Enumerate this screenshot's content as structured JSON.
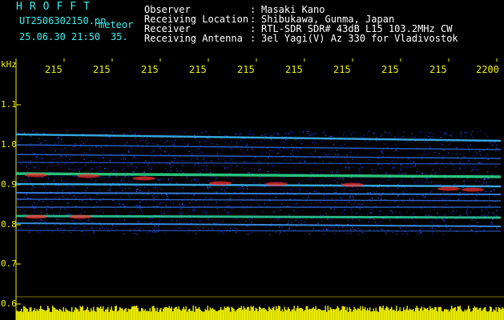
{
  "header": {
    "title": "HROFFT",
    "filename": "UT2506302150.pn",
    "filetype": "meteor",
    "datetime": "25.06.30 21:50",
    "value": "35."
  },
  "meta": [
    {
      "label": "Observer",
      "value": "Masaki Kano"
    },
    {
      "label": "Receiving Location",
      "value": "Shibukawa, Gunma, Japan"
    },
    {
      "label": "Receiver",
      "value": "RTL-SDR SDR# 43dB L15 103.2MHz CW"
    },
    {
      "label": "Receiving Antenna",
      "value": "3el Yagi(V) Az 330 for Vladivostok"
    }
  ],
  "meta_sep": ":",
  "axes": {
    "y_unit": "kHz",
    "y_ticks": [
      "1.1",
      "1.0",
      "0.9",
      "0.8",
      "0.7",
      "0.6"
    ],
    "x_ticks": [
      "215",
      "215",
      "215",
      "215",
      "215",
      "215",
      "215",
      "215",
      "215",
      "2200"
    ]
  },
  "colors": {
    "background": "#000000",
    "text_cyan": "#3cf0f0",
    "text_yellow": "#f0f000",
    "spectrum_low": "#000080",
    "spectrum_mid": "#00c000",
    "spectrum_high": "#ff2020",
    "meter": "#f0f000"
  }
}
